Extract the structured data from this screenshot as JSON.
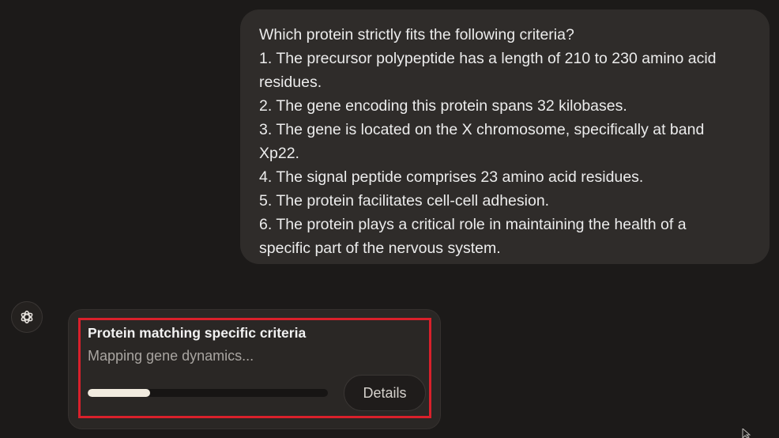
{
  "user_message": {
    "lines": [
      "Which protein strictly fits the following criteria?",
      "1. The precursor polypeptide has a length of 210 to 230 amino acid",
      "residues.",
      "2. The gene encoding this protein spans 32 kilobases.",
      "3. The gene is located on the X chromosome, specifically at band",
      "Xp22.",
      "4. The signal peptide comprises 23 amino acid residues.",
      "5. The protein facilitates cell-cell adhesion.",
      "6. The protein plays a critical role in maintaining the health of a",
      "specific part of the nervous system."
    ]
  },
  "assistant": {
    "avatar_icon": "openai-logo-icon"
  },
  "task_card": {
    "title": "Protein matching specific criteria",
    "status": "Mapping gene dynamics...",
    "progress_fraction": 0.26,
    "details_label": "Details",
    "highlight_color": "#d9202b"
  },
  "cursor_icon": "mouse-pointer-icon"
}
